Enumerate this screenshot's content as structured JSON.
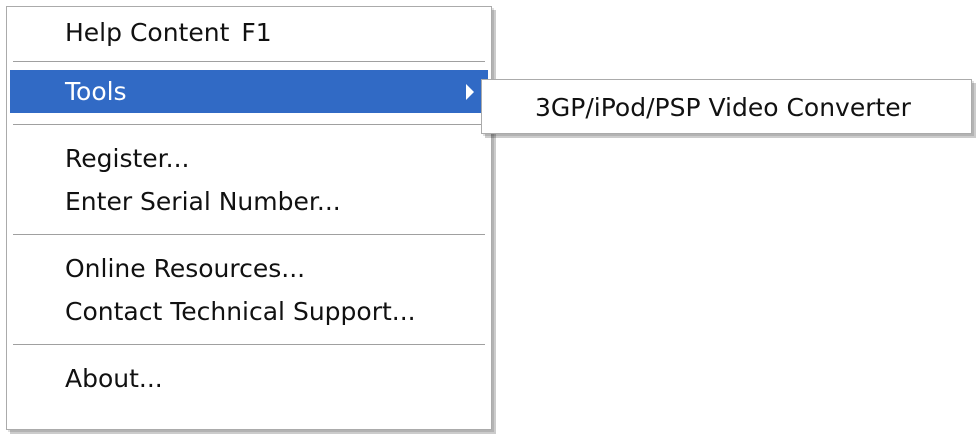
{
  "main_menu": {
    "help_content": {
      "label": "Help Content",
      "shortcut": "F1"
    },
    "tools": {
      "label": "Tools"
    },
    "register": {
      "label": "Register..."
    },
    "enter_serial": {
      "label": "Enter Serial Number..."
    },
    "online_resources": {
      "label": "Online Resources..."
    },
    "contact_support": {
      "label": "Contact Technical Support..."
    },
    "about": {
      "label": "About..."
    }
  },
  "submenu": {
    "items": [
      {
        "label": "3GP/iPod/PSP Video Converter"
      }
    ]
  },
  "colors": {
    "highlight": "#316ac5",
    "menu_background": "#ffffff",
    "separator": "#a0a0a0"
  }
}
